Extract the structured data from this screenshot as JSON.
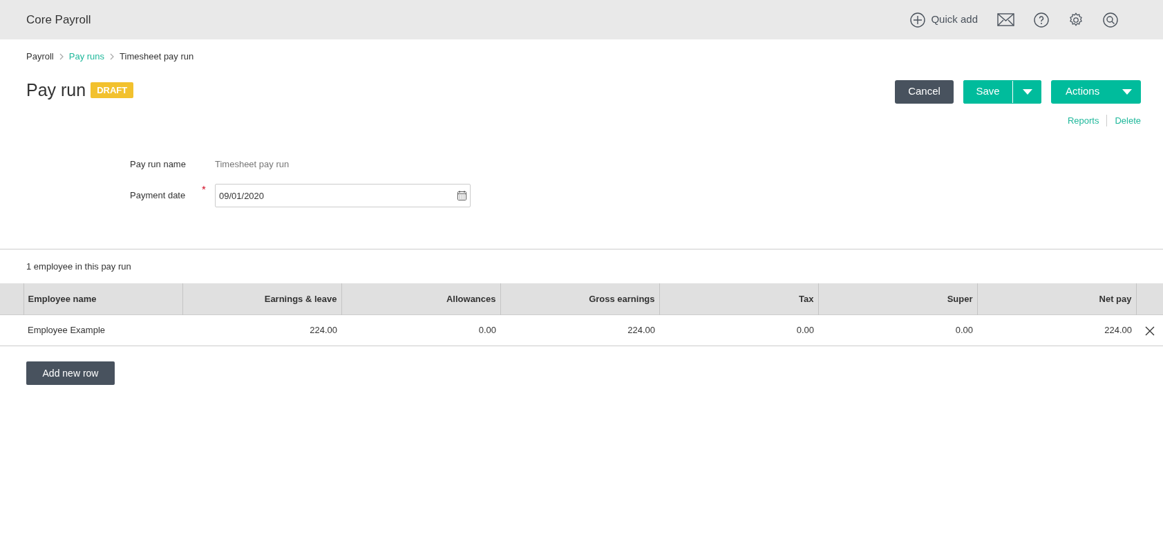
{
  "app": {
    "title": "Core Payroll",
    "quick_add": "Quick add"
  },
  "breadcrumb": [
    {
      "label": "Payroll",
      "kind": "text"
    },
    {
      "label": "Pay runs",
      "kind": "link"
    },
    {
      "label": "Timesheet pay run",
      "kind": "text"
    }
  ],
  "page": {
    "title": "Pay run",
    "status": "DRAFT"
  },
  "buttons": {
    "cancel": "Cancel",
    "save": "Save",
    "actions": "Actions"
  },
  "links": [
    "Reports",
    "Delete"
  ],
  "form": {
    "name_label": "Pay run name",
    "name_value": "Timesheet pay run",
    "date_label": "Payment date",
    "date_required_mark": "*",
    "date_value": "09/01/2020"
  },
  "summary": "1 employee in this pay run",
  "table": {
    "columns": [
      "Employee name",
      "Earnings & leave",
      "Allowances",
      "Gross earnings",
      "Tax",
      "Super",
      "Net pay"
    ],
    "rows": [
      {
        "cells": [
          "Employee Example",
          "224.00",
          "0.00",
          "224.00",
          "0.00",
          "0.00",
          "224.00"
        ]
      }
    ]
  },
  "add_row": "Add new row"
}
